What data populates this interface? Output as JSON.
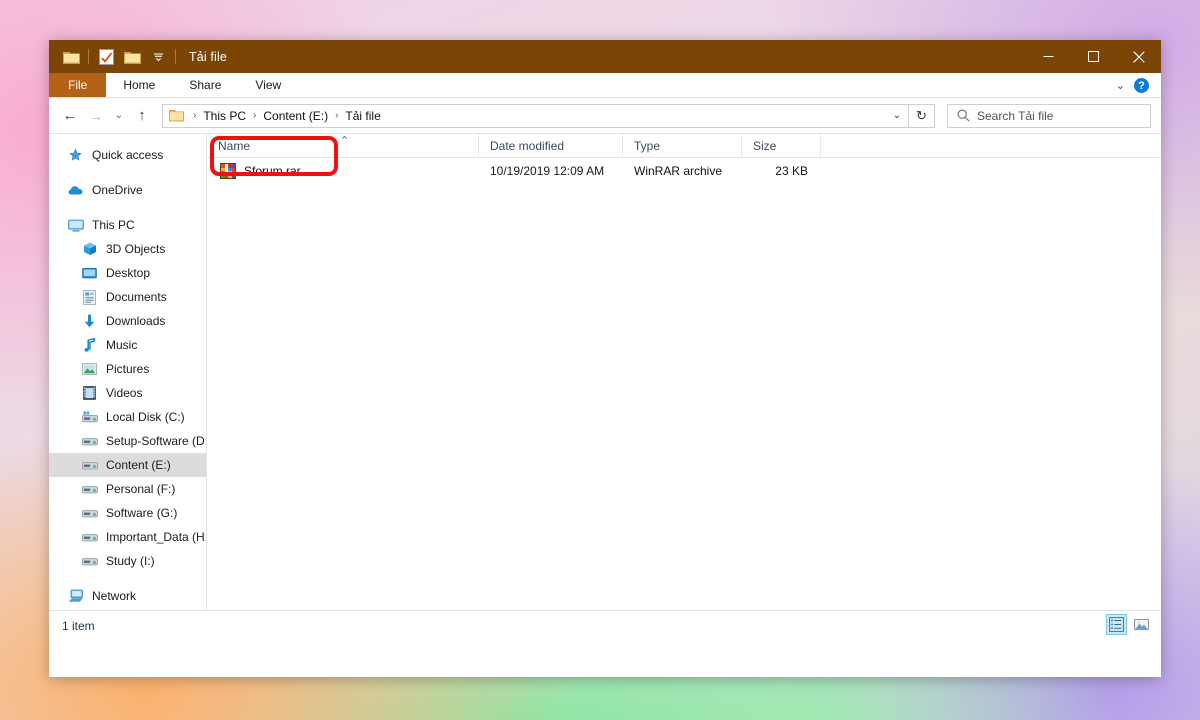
{
  "window": {
    "title": "Tải file",
    "quick_access": [
      {
        "name": "folder-icon",
        "label": "Folder"
      },
      {
        "name": "properties-icon",
        "label": "Properties"
      },
      {
        "name": "new-folder-icon",
        "label": "New folder"
      },
      {
        "name": "customize-chevron-icon",
        "label": "Customize Quick Access Toolbar"
      }
    ],
    "controls": {
      "minimize": "—",
      "maximize": "☐",
      "close": "✕"
    }
  },
  "ribbon": {
    "tabs": [
      {
        "label": "File",
        "active": true
      },
      {
        "label": "Home",
        "active": false
      },
      {
        "label": "Share",
        "active": false
      },
      {
        "label": "View",
        "active": false
      }
    ],
    "expand_label": "⌄",
    "help_label": "?"
  },
  "addressbar": {
    "back": "←",
    "forward": "→",
    "recent": "⌄",
    "up": "↑",
    "breadcrumbs": [
      {
        "label": "This PC"
      },
      {
        "label": "Content (E:)"
      },
      {
        "label": "Tải file"
      }
    ],
    "separator": "›",
    "dropdown": "⌄",
    "refresh": "↻"
  },
  "search": {
    "placeholder": "Search Tải file",
    "value": "",
    "icon": "search-icon"
  },
  "sidebar": {
    "items": [
      {
        "label": "Quick access",
        "icon": "star-pin-icon",
        "indent": false,
        "selected": false
      },
      {
        "label": "OneDrive",
        "icon": "cloud-icon",
        "indent": false,
        "selected": false
      },
      {
        "label": "This PC",
        "icon": "monitor-icon",
        "indent": false,
        "selected": false
      },
      {
        "label": "3D Objects",
        "icon": "cube-icon",
        "indent": true,
        "selected": false
      },
      {
        "label": "Desktop",
        "icon": "desktop-icon",
        "indent": true,
        "selected": false
      },
      {
        "label": "Documents",
        "icon": "documents-icon",
        "indent": true,
        "selected": false
      },
      {
        "label": "Downloads",
        "icon": "download-arrow-icon",
        "indent": true,
        "selected": false
      },
      {
        "label": "Music",
        "icon": "music-note-icon",
        "indent": true,
        "selected": false
      },
      {
        "label": "Pictures",
        "icon": "picture-icon",
        "indent": true,
        "selected": false
      },
      {
        "label": "Videos",
        "icon": "film-icon",
        "indent": true,
        "selected": false
      },
      {
        "label": "Local Disk (C:)",
        "icon": "windows-drive-icon",
        "indent": true,
        "selected": false
      },
      {
        "label": "Setup-Software (D:)",
        "icon": "drive-icon",
        "indent": true,
        "selected": false
      },
      {
        "label": "Content (E:)",
        "icon": "drive-icon",
        "indent": true,
        "selected": true
      },
      {
        "label": "Personal (F:)",
        "icon": "drive-icon",
        "indent": true,
        "selected": false
      },
      {
        "label": "Software (G:)",
        "icon": "drive-icon",
        "indent": true,
        "selected": false
      },
      {
        "label": "Important_Data (H:)",
        "icon": "drive-icon",
        "indent": true,
        "selected": false
      },
      {
        "label": "Study (I:)",
        "icon": "drive-icon",
        "indent": true,
        "selected": false
      },
      {
        "label": "Network",
        "icon": "network-icon",
        "indent": false,
        "selected": false
      }
    ]
  },
  "filelist": {
    "columns": [
      {
        "label": "Name",
        "key": "name"
      },
      {
        "label": "Date modified",
        "key": "date"
      },
      {
        "label": "Type",
        "key": "type"
      },
      {
        "label": "Size",
        "key": "size"
      }
    ],
    "sort_indicator": "⌃",
    "rows": [
      {
        "name": "Sforum.rar",
        "date": "10/19/2019 12:09 AM",
        "type": "WinRAR archive",
        "size": "23 KB",
        "icon": "winrar-archive-icon",
        "highlighted": true
      }
    ]
  },
  "statusbar": {
    "item_count": "1 item",
    "views": [
      {
        "name": "details-view-button",
        "label": "Details view",
        "active": true
      },
      {
        "name": "large-icons-view-button",
        "label": "Large icons view",
        "active": false
      }
    ]
  },
  "annotation": {
    "color": "#ee1111",
    "target": "Sforum.rar"
  }
}
